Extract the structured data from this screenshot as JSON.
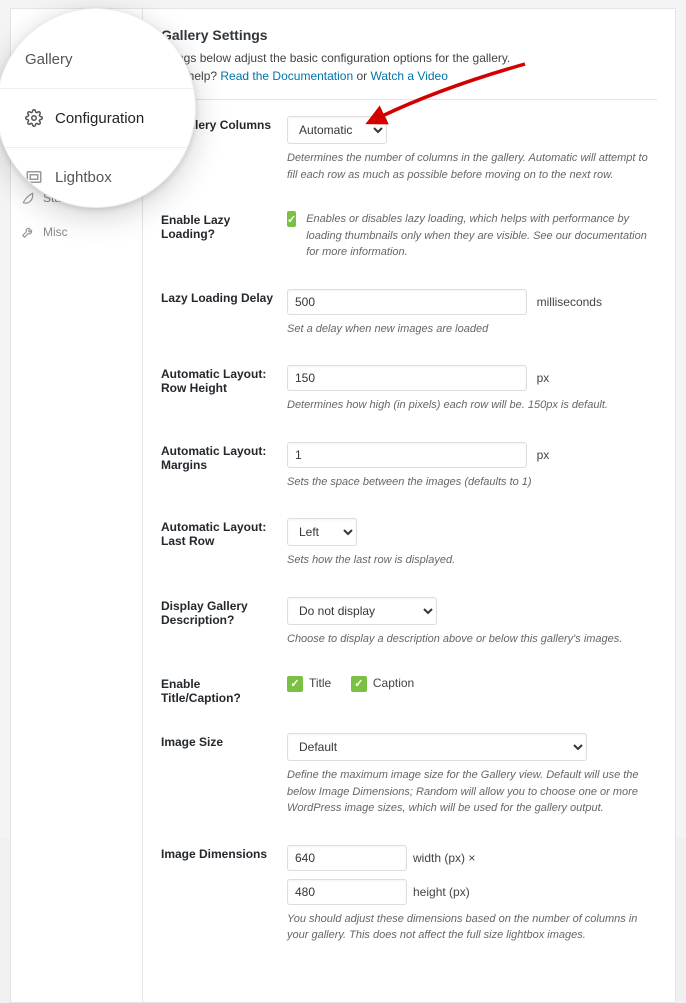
{
  "sidebar": {
    "items": [
      {
        "label": "Standard"
      },
      {
        "label": "Misc"
      }
    ]
  },
  "lens": {
    "gallery": "Gallery",
    "configuration": "Configuration",
    "lightbox": "Lightbox"
  },
  "title": "Gallery Settings",
  "intro_pre": "ettings below adjust the basic configuration options for the gallery.",
  "intro_line2_pre": "ome help?",
  "intro_link1": "Read the Documentation",
  "intro_or": "or",
  "intro_link2": "Watch a Video",
  "rows": {
    "cols": {
      "label": "of Gallery Columns",
      "value": "Automatic",
      "help": "Determines the number of columns in the gallery. Automatic will attempt to fill each row as much as possible before moving on to the next row."
    },
    "lazy": {
      "label": "Enable Lazy Loading?",
      "help": "Enables or disables lazy loading, which helps with performance by loading thumbnails only when they are visible. See our documentation for more information."
    },
    "delay": {
      "label": "Lazy Loading Delay",
      "value": "500",
      "suffix": "milliseconds",
      "help": "Set a delay when new images are loaded"
    },
    "rowh": {
      "label": "Automatic Layout: Row Height",
      "value": "150",
      "suffix": "px",
      "help": "Determines how high (in pixels) each row will be. 150px is default."
    },
    "margins": {
      "label": "Automatic Layout: Margins",
      "value": "1",
      "suffix": "px",
      "help": "Sets the space between the images (defaults to 1)"
    },
    "lastrow": {
      "label": "Automatic Layout: Last Row",
      "value": "Left",
      "help": "Sets how the last row is displayed."
    },
    "desc": {
      "label": "Display Gallery Description?",
      "value": "Do not display",
      "help": "Choose to display a description above or below this gallery's images."
    },
    "titlecap": {
      "label": "Enable Title/Caption?",
      "cb1": "Title",
      "cb2": "Caption"
    },
    "imgsize": {
      "label": "Image Size",
      "value": "Default",
      "help": "Define the maximum image size for the Gallery view. Default will use the below Image Dimensions; Random will allow you to choose one or more WordPress image sizes, which will be used for the gallery output."
    },
    "dims": {
      "label": "Image Dimensions",
      "w": "640",
      "wsuf": "width (px) ×",
      "h": "480",
      "hsuf": "height (px)",
      "help": "You should adjust these dimensions based on the number of columns in your gallery. This does not affect the full size lightbox images."
    }
  }
}
